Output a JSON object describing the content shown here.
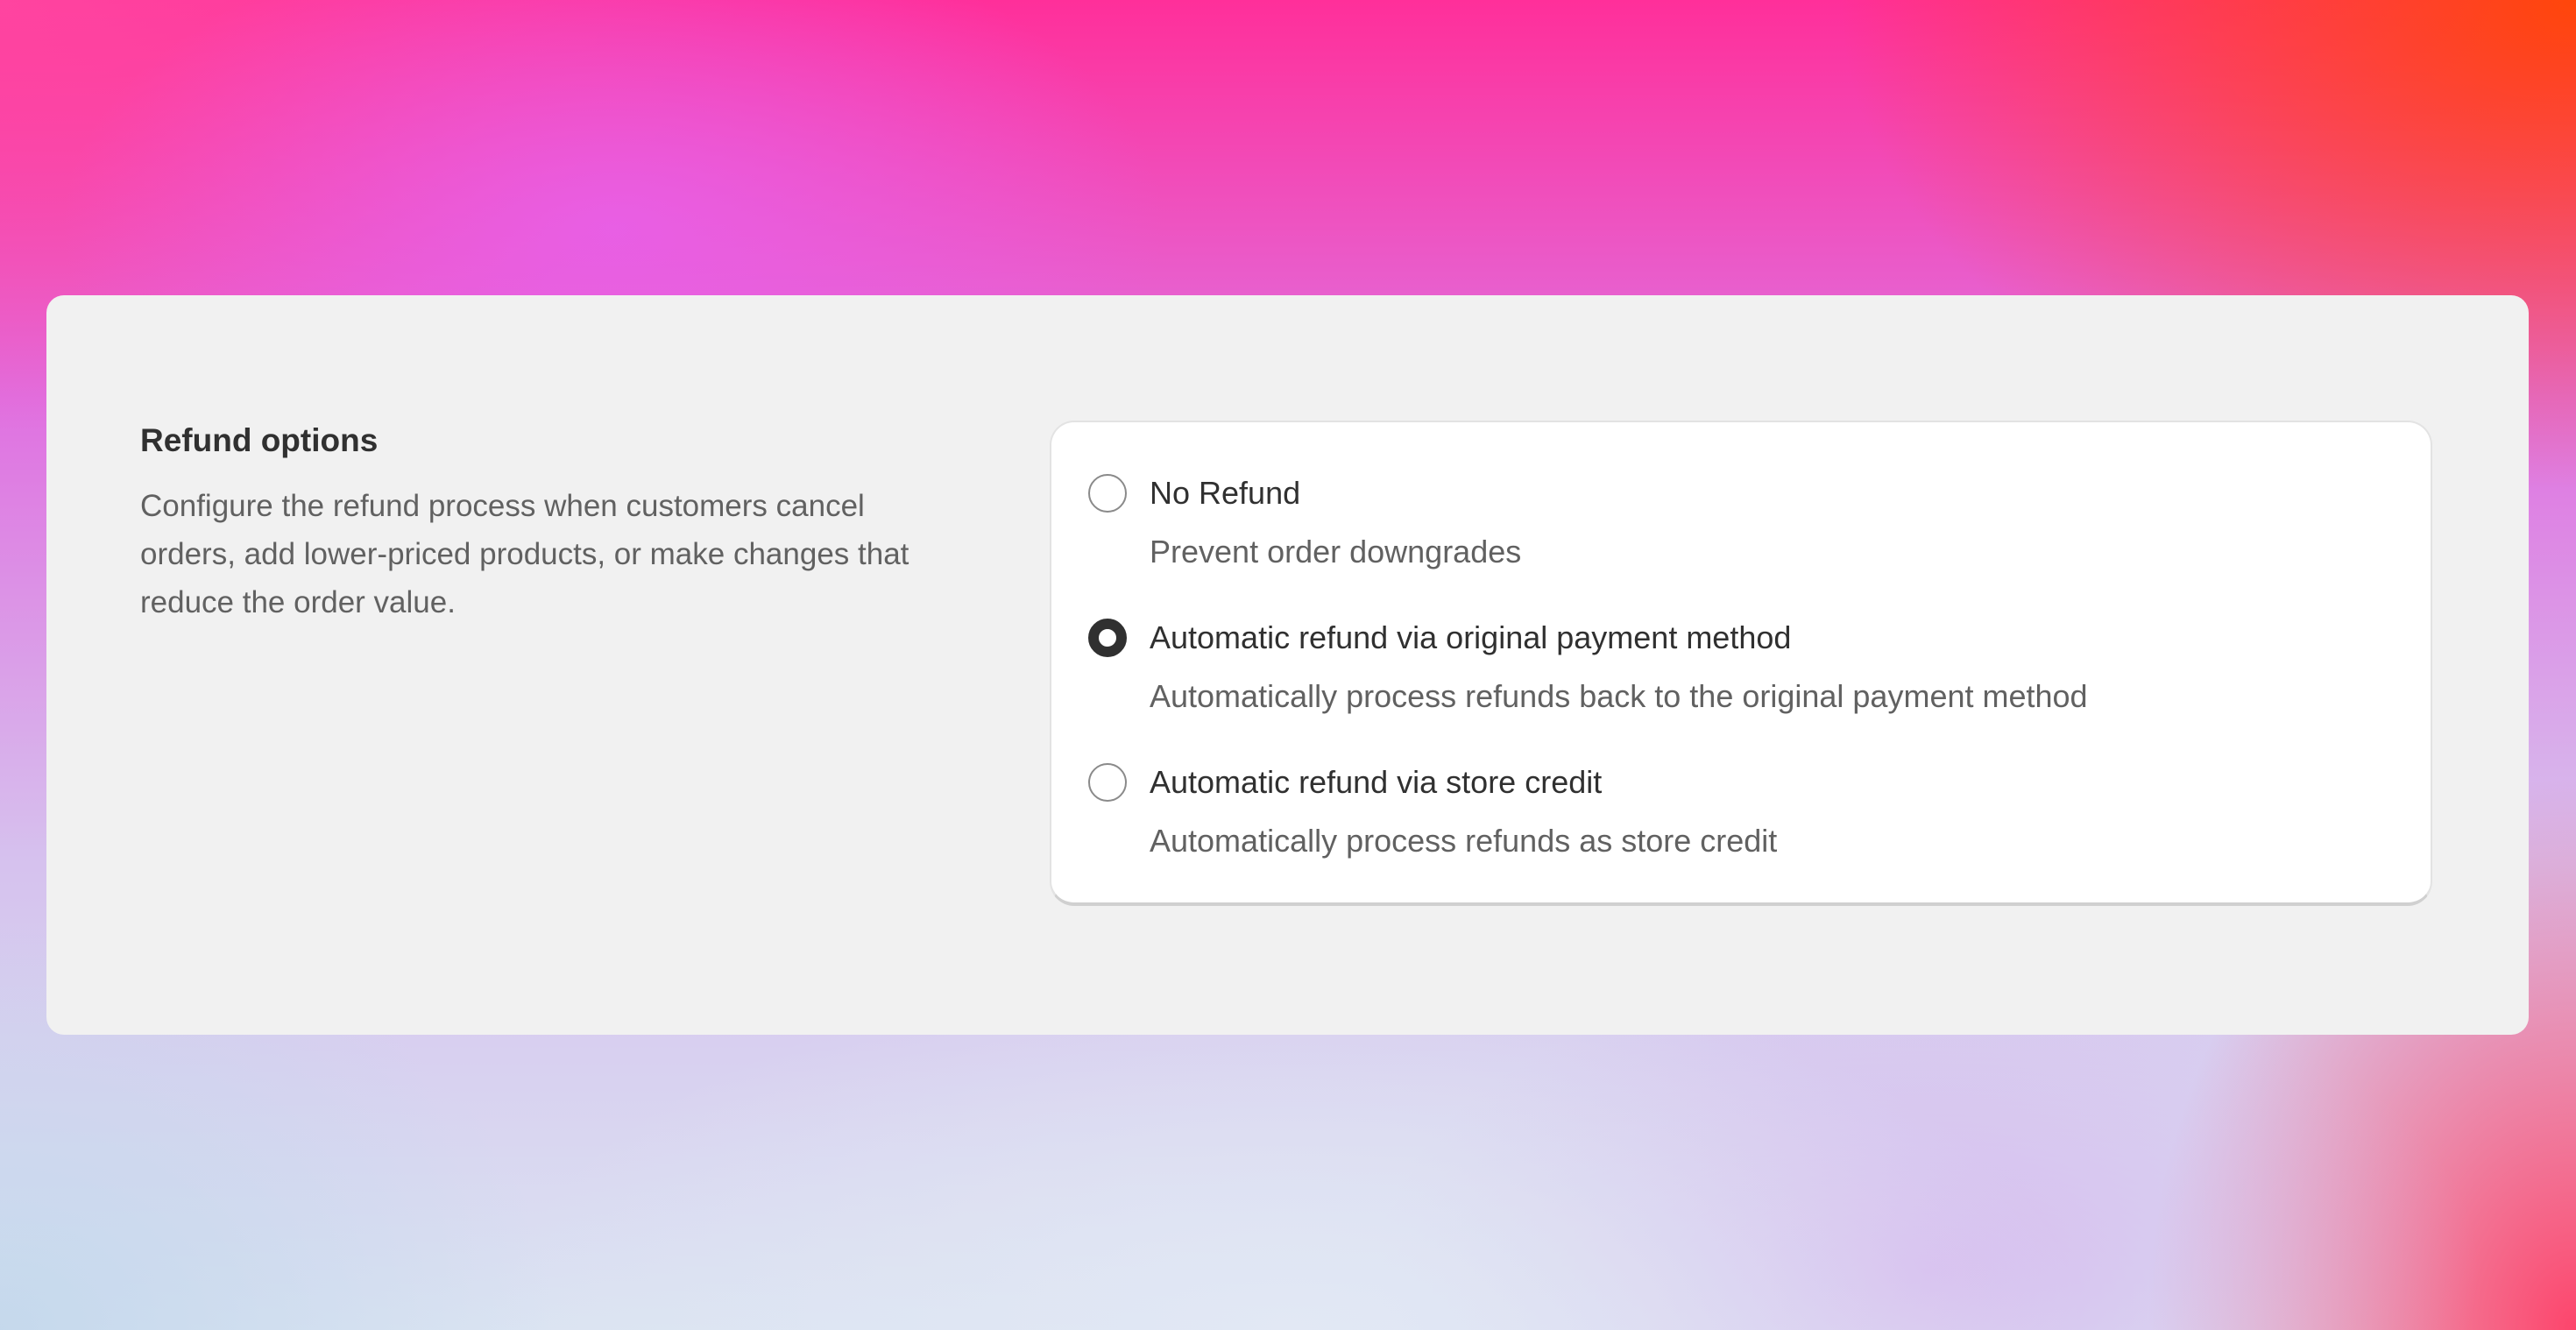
{
  "section": {
    "title": "Refund options",
    "description": "Configure the refund process when customers cancel orders, add lower-priced products, or make changes that reduce the order value."
  },
  "refund_options": {
    "selected": "original_payment_method",
    "items": [
      {
        "id": "no_refund",
        "label": "No Refund",
        "help": "Prevent order downgrades",
        "checked": false
      },
      {
        "id": "original_payment_method",
        "label": "Automatic refund via original payment method",
        "help": "Automatically process refunds back to the original payment method",
        "checked": true
      },
      {
        "id": "store_credit",
        "label": "Automatic refund via store credit",
        "help": "Automatically process refunds as store credit",
        "checked": false
      }
    ]
  },
  "colors": {
    "panel_background": "#f1f1f1",
    "card_background": "#ffffff",
    "text_primary": "#303030",
    "text_secondary": "#616161",
    "radio_checked": "#303030"
  }
}
